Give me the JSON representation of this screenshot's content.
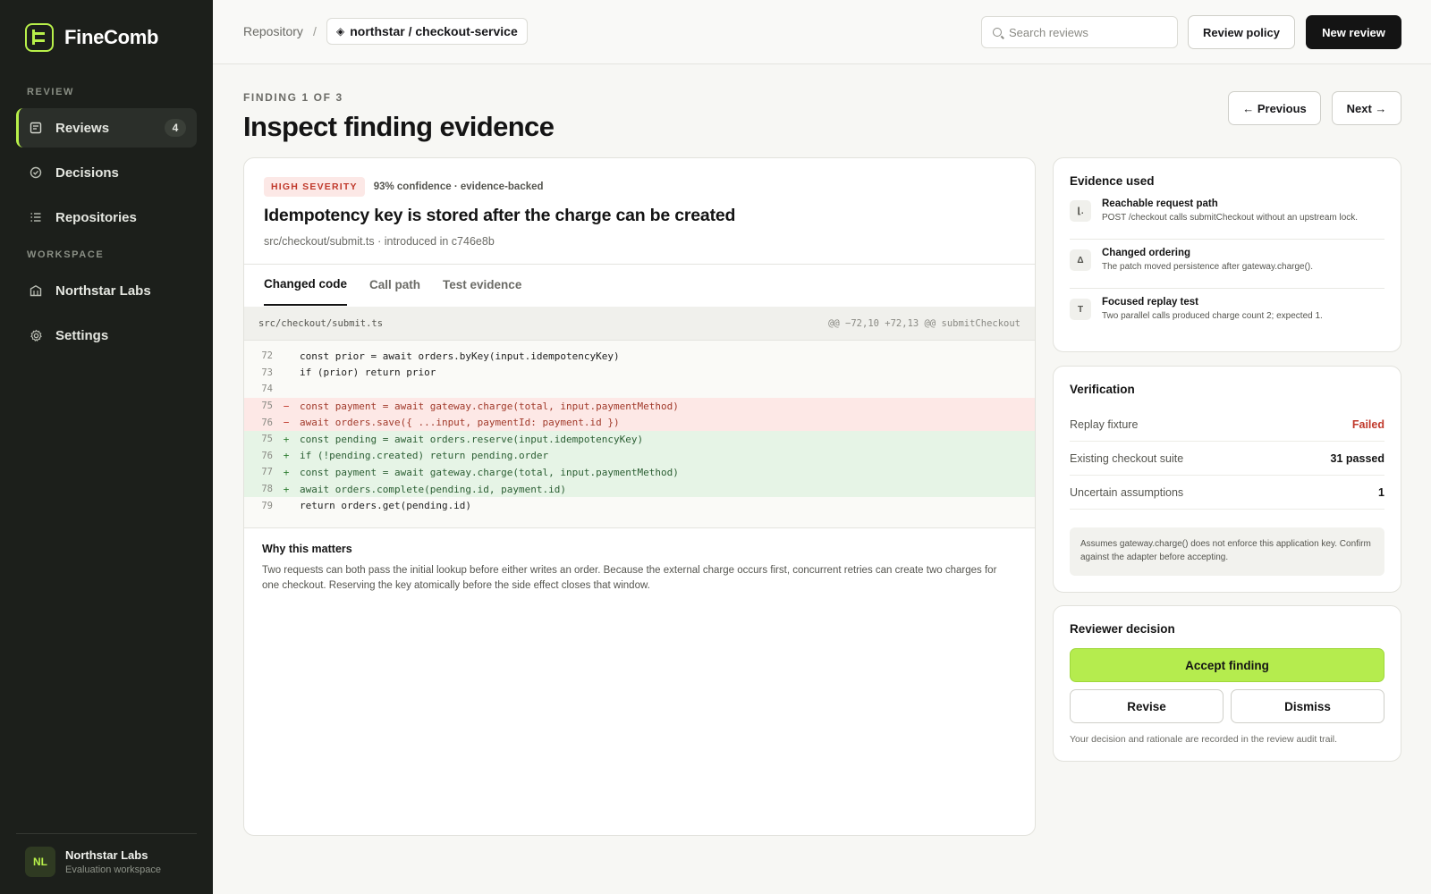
{
  "brand": {
    "name": "FineComb"
  },
  "sidebar": {
    "sections": {
      "review": "REVIEW",
      "workspace": "WORKSPACE"
    },
    "items": [
      {
        "label": "Reviews",
        "badge": "4",
        "icon": "reviews-icon"
      },
      {
        "label": "Decisions",
        "icon": "check-circle-icon"
      },
      {
        "label": "Repositories",
        "icon": "list-icon"
      },
      {
        "label": "Northstar Labs",
        "icon": "building-icon"
      },
      {
        "label": "Settings",
        "icon": "gear-icon"
      }
    ],
    "footer": {
      "initials": "NL",
      "name": "Northstar Labs",
      "subtitle": "Evaluation workspace"
    }
  },
  "topbar": {
    "breadcrumb_root": "Repository",
    "breadcrumb_sep": "/",
    "repo_name": "northstar / checkout-service",
    "search_placeholder": "Search reviews",
    "review_policy_label": "Review policy",
    "new_review_label": "New review"
  },
  "heading": {
    "eyebrow": "FINDING 1 OF 3",
    "title": "Inspect finding evidence",
    "previous_label": "← Previous",
    "next_label": "Next →"
  },
  "finding": {
    "severity": "HIGH SEVERITY",
    "confidence": "93% confidence · evidence-backed",
    "title": "Idempotency key is stored after the charge can be created",
    "meta": "src/checkout/submit.ts · introduced in c746e8b",
    "tabs": [
      "Changed code",
      "Call path",
      "Test evidence"
    ],
    "diff": {
      "file": "src/checkout/submit.ts",
      "hunk": "@@ −72,10 +72,13 @@ submitCheckout",
      "lines": [
        {
          "n": "72",
          "mark": "",
          "type": "ctx",
          "code": "const prior = await orders.byKey(input.idempotencyKey)"
        },
        {
          "n": "73",
          "mark": "",
          "type": "ctx",
          "code": "if (prior) return prior"
        },
        {
          "n": "74",
          "mark": "",
          "type": "ctx",
          "code": ""
        },
        {
          "n": "75",
          "mark": "−",
          "type": "del",
          "code": "const payment = await gateway.charge(total, input.paymentMethod)"
        },
        {
          "n": "76",
          "mark": "−",
          "type": "del",
          "code": "await orders.save({ ...input, paymentId: payment.id })"
        },
        {
          "n": "75",
          "mark": "+",
          "type": "add",
          "code": "const pending = await orders.reserve(input.idempotencyKey)"
        },
        {
          "n": "76",
          "mark": "+",
          "type": "add",
          "code": "if (!pending.created) return pending.order"
        },
        {
          "n": "77",
          "mark": "+",
          "type": "add",
          "code": "const payment = await gateway.charge(total, input.paymentMethod)"
        },
        {
          "n": "78",
          "mark": "+",
          "type": "add",
          "code": "await orders.complete(pending.id, payment.id)"
        },
        {
          "n": "79",
          "mark": "",
          "type": "ctx",
          "code": "return orders.get(pending.id)"
        }
      ]
    },
    "why_title": "Why this matters",
    "why_body": "Two requests can both pass the initial lookup before either writes an order. Because the external charge occurs first, concurrent retries can create two charges for one checkout. Reserving the key atomically before the side effect closes that window."
  },
  "evidence": {
    "title": "Evidence used",
    "items": [
      {
        "icon": "⌊.",
        "name": "Reachable request path",
        "desc": "POST /checkout calls submitCheckout without an upstream lock."
      },
      {
        "icon": "Δ",
        "name": "Changed ordering",
        "desc": "The patch moved persistence after gateway.charge()."
      },
      {
        "icon": "T",
        "name": "Focused replay test",
        "desc": "Two parallel calls produced charge count 2; expected 1."
      }
    ]
  },
  "verification": {
    "title": "Verification",
    "rows": [
      {
        "label": "Replay fixture",
        "value": "Failed"
      },
      {
        "label": "Existing checkout suite",
        "value": "31 passed"
      },
      {
        "label": "Uncertain assumptions",
        "value": "1"
      }
    ],
    "note": "Assumes gateway.charge() does not enforce this application key. Confirm against the adapter before accepting."
  },
  "decision": {
    "title": "Reviewer decision",
    "accept_label": "Accept finding",
    "revise_label": "Revise",
    "dismiss_label": "Dismiss",
    "note": "Your decision and rationale are recorded in the review audit trail."
  },
  "colors": {
    "accent": "#b8f04a",
    "sidebar": "#1c1f1b",
    "danger": "#c0392b",
    "success": "#2e7d32"
  }
}
